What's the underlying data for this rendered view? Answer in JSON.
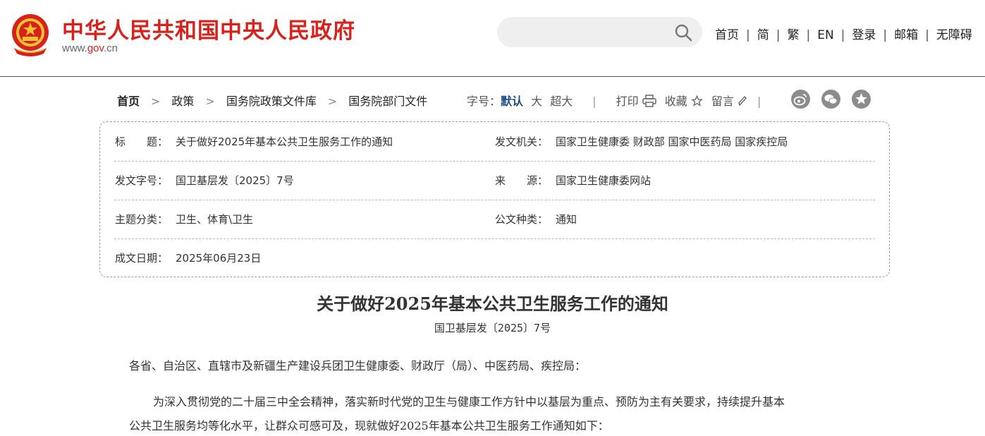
{
  "header": {
    "site_title": "中华人民共和国中央人民政府",
    "url_prefix": "www.",
    "url_domain": "gov",
    "url_suffix": ".cn",
    "search_placeholder": "",
    "search_icon": "search-icon",
    "nav": [
      "首页",
      "简",
      "繁",
      "EN",
      "登录",
      "邮箱",
      "无障碍"
    ],
    "brand_color": "#d7221c"
  },
  "breadcrumb": [
    "首页",
    "政策",
    "国务院政策文件库",
    "国务院部门文件"
  ],
  "tools": {
    "font_size_label": "字号：",
    "font_default": "默认",
    "font_large": "大",
    "font_xlarge": "超大",
    "print": "打印",
    "favorite": "收藏",
    "comment": "留言",
    "social_icons": [
      "weibo-icon",
      "wechat-icon",
      "star-share-icon"
    ]
  },
  "info": {
    "title_label": "标　　题：",
    "title_value": "关于做好2025年基本公共卫生服务工作的通知",
    "issuer_label": "发文机关：",
    "issuer_value": "国家卫生健康委 财政部 国家中医药局 国家疾控局",
    "docno_label": "发文字号：",
    "docno_value": "国卫基层发〔2025〕7号",
    "source_label": "来　　源：",
    "source_value": "国家卫生健康委网站",
    "topic_label": "主题分类：",
    "topic_value": "卫生、体育\\卫生",
    "type_label": "公文种类：",
    "type_value": "通知",
    "date_label": "成文日期：",
    "date_value": "2025年06月23日"
  },
  "article": {
    "title": "关于做好2025年基本公共卫生服务工作的通知",
    "doc_no": "国卫基层发〔2025〕7号",
    "salutation": "各省、自治区、直辖市及新疆生产建设兵团卫生健康委、财政厅（局）、中医药局、疾控局：",
    "para1_line1": "为深入贯彻党的二十届三中全会精神，落实新时代党的卫生与健康工作方针中以基层为重点、预防为主有关要求，持续提升基本",
    "para1_line2": "公共卫生服务均等化水平，让群众可感可及，现就做好2025年基本公共卫生服务工作通知如下："
  }
}
